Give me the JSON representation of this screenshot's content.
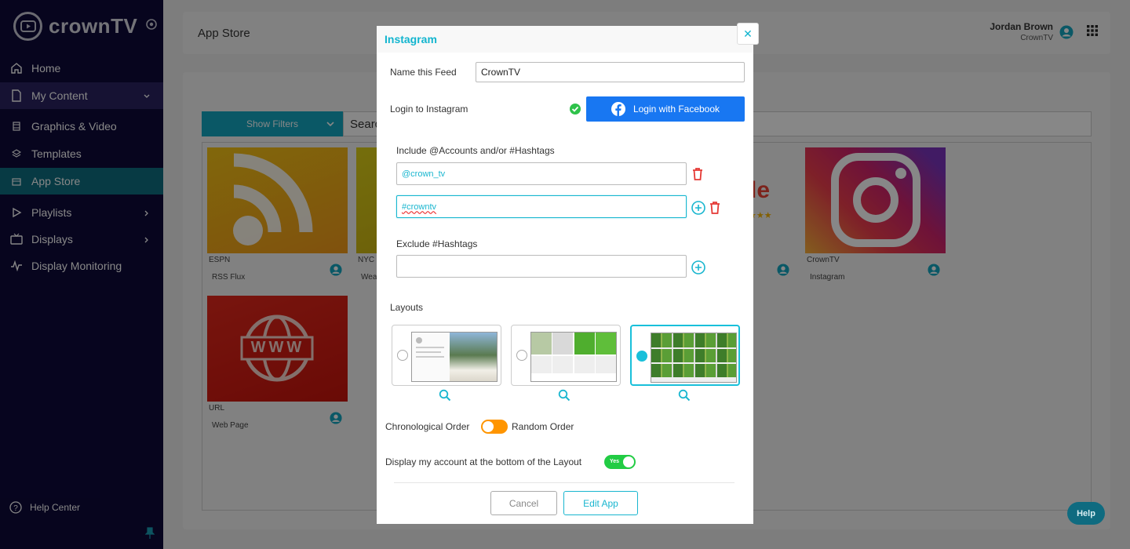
{
  "brand": {
    "name": "crownTV"
  },
  "sidebar": {
    "items": [
      {
        "label": "Home"
      },
      {
        "label": "My Content"
      },
      {
        "label": "Graphics & Video"
      },
      {
        "label": "Templates"
      },
      {
        "label": "App Store"
      },
      {
        "label": "Playlists"
      },
      {
        "label": "Displays"
      },
      {
        "label": "Display Monitoring"
      }
    ],
    "help_center": "Help Center"
  },
  "header": {
    "title": "App Store",
    "user_name": "Jordan Brown",
    "user_org": "CrownTV"
  },
  "toolbar": {
    "filter_label": "Show Filters",
    "search_text": "Searc"
  },
  "apps": [
    {
      "title": "ESPN",
      "subtitle": "RSS Flux"
    },
    {
      "title": "NYC",
      "subtitle": "Wea"
    },
    {
      "title": "",
      "subtitle": ""
    },
    {
      "title": "CrownTV",
      "subtitle": "Instagram"
    },
    {
      "title": "URL",
      "subtitle": "Web Page"
    }
  ],
  "app_text": {
    "partial_logo": "le",
    "stars": "★★★",
    "www": "WWW"
  },
  "modal": {
    "title": "Instagram",
    "close_glyph": "✕",
    "name_label": "Name this Feed",
    "name_value": "CrownTV",
    "login_label": "Login to Instagram",
    "fb_button": "Login with Facebook",
    "include_label": "Include @Accounts and/or #Hashtags",
    "include_values": [
      "@crown_tv",
      "#crowntv"
    ],
    "exclude_label": "Exclude #Hashtags",
    "exclude_value": "",
    "layouts_label": "Layouts",
    "chrono_label": "Chronological Order",
    "random_label": "Random Order",
    "display_account_label": "Display my account at the bottom of the Layout",
    "yes_label": "Yes",
    "cancel_label": "Cancel",
    "edit_label": "Edit App"
  },
  "help_button": "Help",
  "colors": {
    "sidebar_bg": "#0e0a3a",
    "accent": "#14a7c0",
    "facebook": "#1877f2",
    "toggle_orange": "#ff9500",
    "toggle_green": "#22cc44",
    "delete_red": "#e53935"
  }
}
